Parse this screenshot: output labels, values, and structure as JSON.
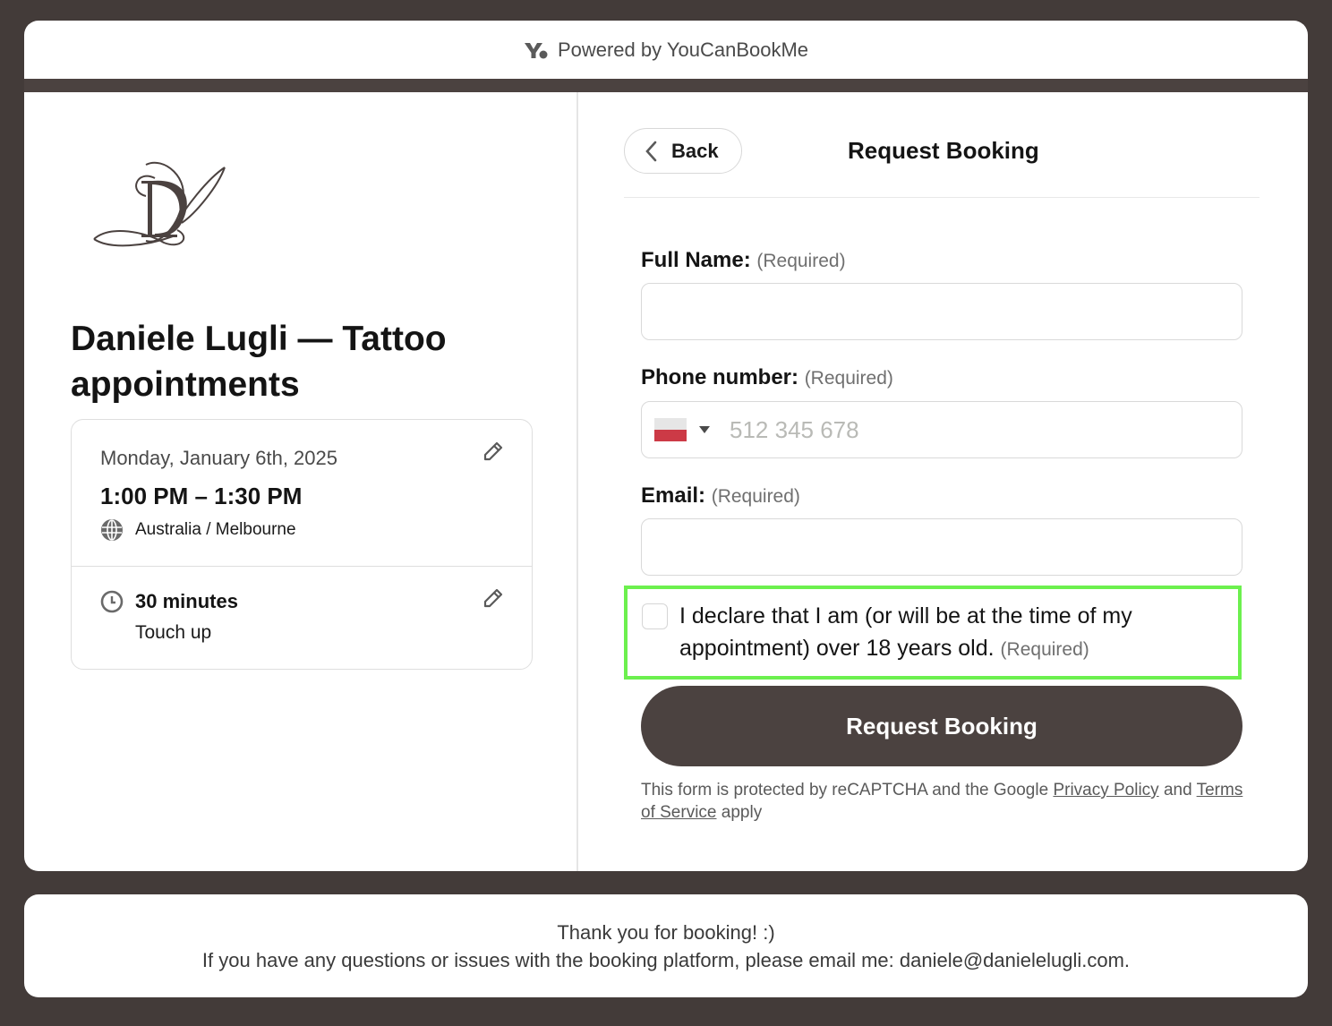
{
  "header": {
    "powered_by": "Powered by YouCanBookMe",
    "logo_icon": "youcanbookme-logo-icon",
    "brand_color": "#4b4240"
  },
  "event": {
    "logo": "daniele-lugli-monogram-logo",
    "title": "Daniele Lugli — Tattoo appointments",
    "date": "Monday, January 6th, 2025",
    "time_range": "1:00 PM – 1:30 PM",
    "timezone": "Australia / Melbourne",
    "duration": "30 minutes",
    "service": "Touch up",
    "icons": {
      "timezone": "globe-icon",
      "duration": "clock-icon",
      "edit": "pencil-icon"
    }
  },
  "form": {
    "back_label": "Back",
    "title": "Request Booking",
    "required_tag": "(Required)",
    "fields": {
      "full_name": {
        "label": "Full Name:",
        "value": "",
        "placeholder": ""
      },
      "phone": {
        "label": "Phone number:",
        "value": "",
        "placeholder": "512 345 678",
        "country_flag": "Poland"
      },
      "email": {
        "label": "Email:",
        "value": "",
        "placeholder": ""
      }
    },
    "consent": {
      "text": "I declare that I am (or will be at the time of my appointment) over 18 years old.",
      "checked": false,
      "highlight_color": "#6cf04e"
    },
    "submit_label": "Request Booking",
    "recaptcha": {
      "prefix": "This form is protected by reCAPTCHA and the Google",
      "privacy_link": "Privacy Policy",
      "middle": "and",
      "terms_link": "Terms of Service",
      "suffix": "apply"
    }
  },
  "footer": {
    "line1": "Thank you for booking! :)",
    "line2": "If you have any questions or issues with the booking platform, please email me: daniele@danielelugli.com."
  }
}
